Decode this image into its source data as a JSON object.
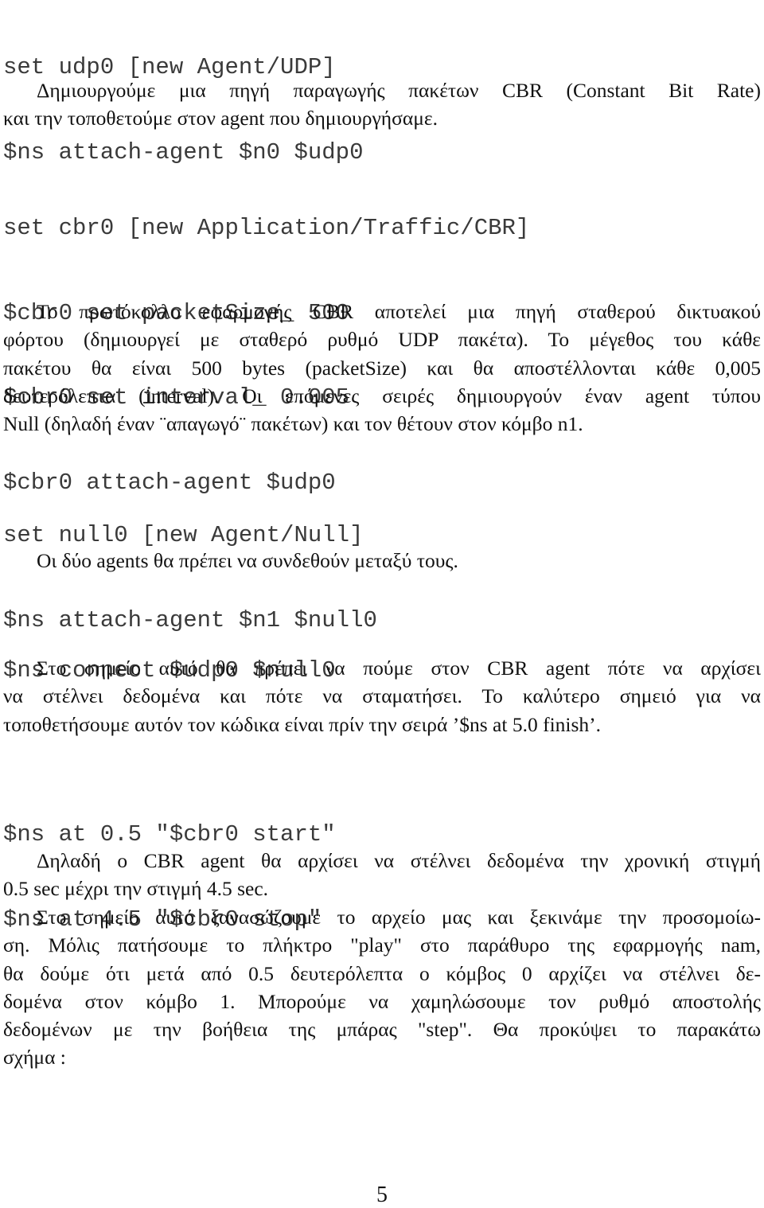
{
  "page_number": "5",
  "code_block_1": [
    "set udp0 [new Agent/UDP]",
    "$ns attach-agent $n0 $udp0"
  ],
  "para_1": [
    "Δημιουργούμε μια πηγή παραγωγής πακέτων CBR (Constant Bit Rate)",
    "και την τοποθετούμε στον agent που δημιουργήσαμε."
  ],
  "code_block_2": [
    "set cbr0 [new Application/Traffic/CBR]",
    "$cbr0 set packetSize_ 500",
    "$cbr0 set interval_ 0.005",
    "$cbr0 attach-agent $udp0"
  ],
  "para_2": [
    "Το πρωτόκολλο εφαρμογής CBR αποτελεί μια πηγή σταθερού δικτυακού",
    "φόρτου (δημιουργεί με σταθερό ρυθμό UDP πακέτα).  Το μέγεθος του κάθε",
    "πακέτου θα είναι 500 bytes (packetSize) και θα αποστέλλονται κάθε 0,005",
    "δευτερόλεπτα (interval).  Οι επόμενες σειρές δημιουργούν έναν agent τύπου",
    "Null (δηλαδή έναν ¨απαγωγό¨ πακέτων) και τον θέτουν στον κόμβο n1."
  ],
  "code_block_3": [
    "set null0 [new Agent/Null]",
    "$ns attach-agent $n1 $null0"
  ],
  "para_3": [
    "Οι δύο agents θα πρέπει να συνδεθούν μεταξύ τους."
  ],
  "code_block_4": [
    "$ns connect $udp0 $null0"
  ],
  "para_4": [
    "Στο σημείο αυτό θα πρέπει να πούμε στον CBR agent πότε να αρχίσει",
    "να στέλνει δεδομένα και πότε να σταματήσει.  Το καλύτερο σημειό για να",
    "τοποθετήσουμε αυτόν τον κώδικα είναι πρίν την σειρά ’$ns at 5.0 finish’."
  ],
  "code_block_5": [
    "$ns at 0.5 \"$cbr0 start\"",
    "$ns at 4.5 \"$cbr0 stop\""
  ],
  "para_5": [
    "Δηλαδή ο CBR agent θα αρχίσει να στέλνει δεδομένα την χρονική στιγμή",
    "0.5 sec μέχρι την στιγμή 4.5 sec."
  ],
  "para_6": [
    "Στο σημείο αυτό ξανασώζουμε το αρχείο μας και ξεκινάμε την προσομοίω-",
    "ση.  Μόλις πατήσουμε το πλήκτρο \"play\" στο παράθυρο της εφαρμογής nam,",
    "θα δούμε ότι μετά από 0.5 δευτερόλεπτα ο κόμβος 0 αρχίζει να στέλνει δε-",
    "δομένα στον κόμβο 1.  Μπορούμε να χαμηλώσουμε τον ρυθμό αποστολής",
    "δεδομένων με την βοήθεια της μπάρας \"step\".  Θα προκύψει το παρακάτω",
    "σχήμα :"
  ]
}
